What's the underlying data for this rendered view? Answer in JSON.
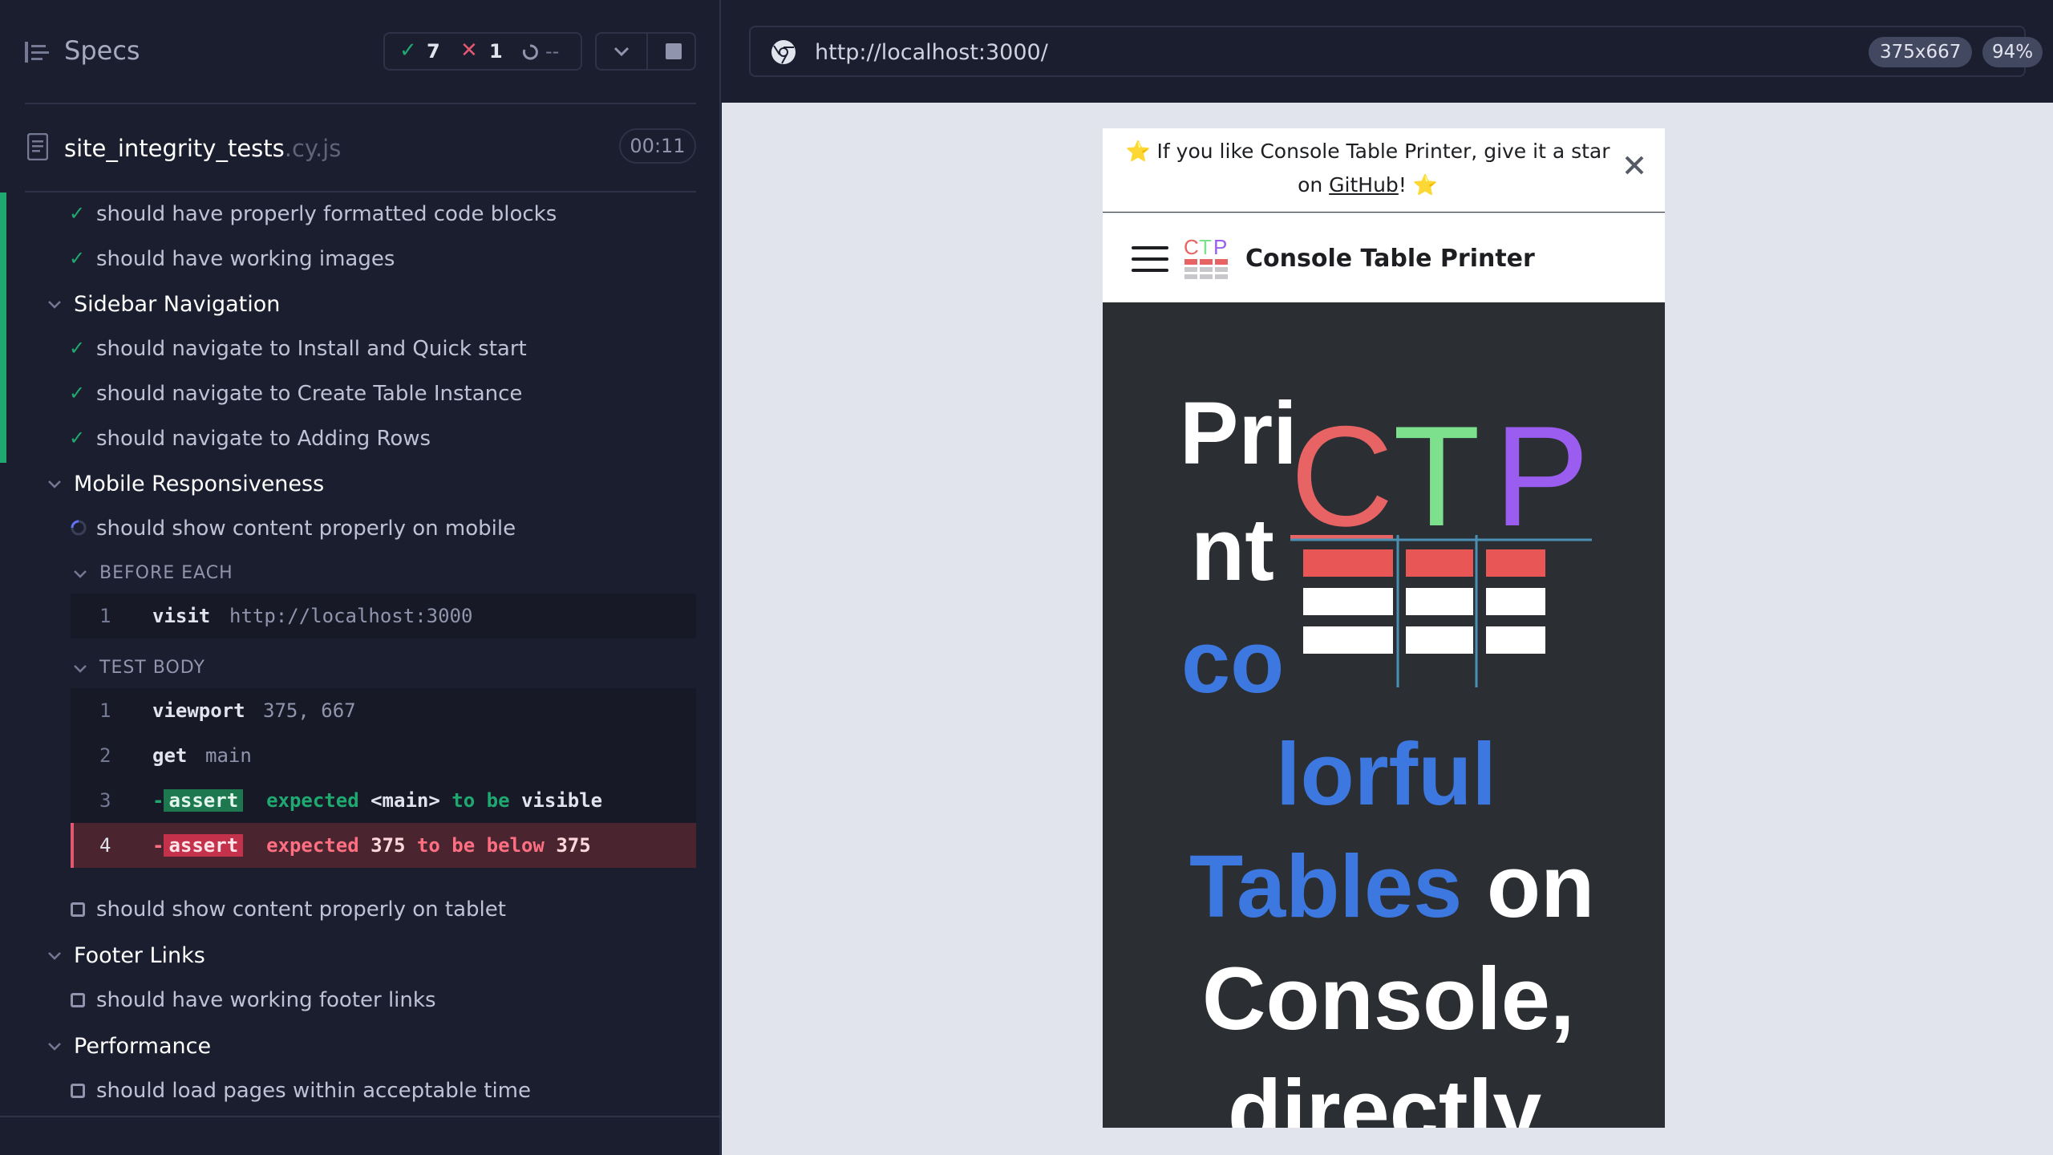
{
  "reporter": {
    "title": "Specs",
    "stats": {
      "passed": "7",
      "failed": "1",
      "pending": "--"
    },
    "file": {
      "name": "site_integrity_tests",
      "ext": ".cy.js",
      "duration": "00:11"
    },
    "rows": [
      {
        "kind": "test",
        "state": "passed",
        "label": "should have properly formatted code blocks"
      },
      {
        "kind": "test",
        "state": "passed",
        "label": "should have working images"
      },
      {
        "kind": "suite",
        "label": "Sidebar Navigation"
      },
      {
        "kind": "test",
        "state": "passed",
        "label": "should navigate to Install and Quick start"
      },
      {
        "kind": "test",
        "state": "passed",
        "label": "should navigate to Create Table Instance"
      },
      {
        "kind": "test",
        "state": "passed",
        "label": "should navigate to Adding Rows"
      },
      {
        "kind": "suite",
        "label": "Mobile Responsiveness"
      },
      {
        "kind": "test",
        "state": "running",
        "label": "should show content properly on mobile"
      },
      {
        "kind": "test",
        "state": "pending",
        "label": "should show content properly on tablet"
      },
      {
        "kind": "suite",
        "label": "Footer Links"
      },
      {
        "kind": "test",
        "state": "pending",
        "label": "should have working footer links"
      },
      {
        "kind": "suite",
        "label": "Performance"
      },
      {
        "kind": "test",
        "state": "pending",
        "label": "should load pages within acceptable time"
      }
    ],
    "before_each": {
      "title": "BEFORE EACH",
      "commands": [
        {
          "num": "1",
          "name": "visit",
          "msg": "http://localhost:3000"
        }
      ]
    },
    "test_body": {
      "title": "TEST BODY",
      "commands": [
        {
          "num": "1",
          "name": "viewport",
          "msg": "375, 667"
        },
        {
          "num": "2",
          "name": "get",
          "msg": "main"
        },
        {
          "num": "3",
          "dash": "-",
          "name": "assert",
          "p1": "expected",
          "p2": "<main>",
          "p3": "to be",
          "p4": "visible"
        },
        {
          "num": "4",
          "dash": "-",
          "name": "assert",
          "p1": "expected",
          "p2": "375",
          "p3": "to be below",
          "p4": "375"
        }
      ]
    }
  },
  "aut": {
    "url": "http://localhost:3000/",
    "viewport": "375x667",
    "zoom": "94%",
    "site": {
      "banner_prefix": "⭐️ If you like Console Table Printer, give it a star on",
      "banner_link": "GitHub",
      "banner_suffix": "! ⭐️",
      "title": "Console Table Printer",
      "logo_letters": [
        "C",
        "T",
        "P"
      ],
      "hero": {
        "w1": "Pri",
        "w2": "nt",
        "w3": "co",
        "w4": "lorful",
        "w5": "Tables",
        "w6": "on",
        "w7": "Console,",
        "w8": "directly"
      }
    },
    "colors": {
      "pass": "#1fa971",
      "fail": "#e45770",
      "logo_c": "#e86464",
      "logo_t": "#7de08c",
      "logo_p": "#9b5df0",
      "hero_blue": "#3c78e0"
    }
  }
}
